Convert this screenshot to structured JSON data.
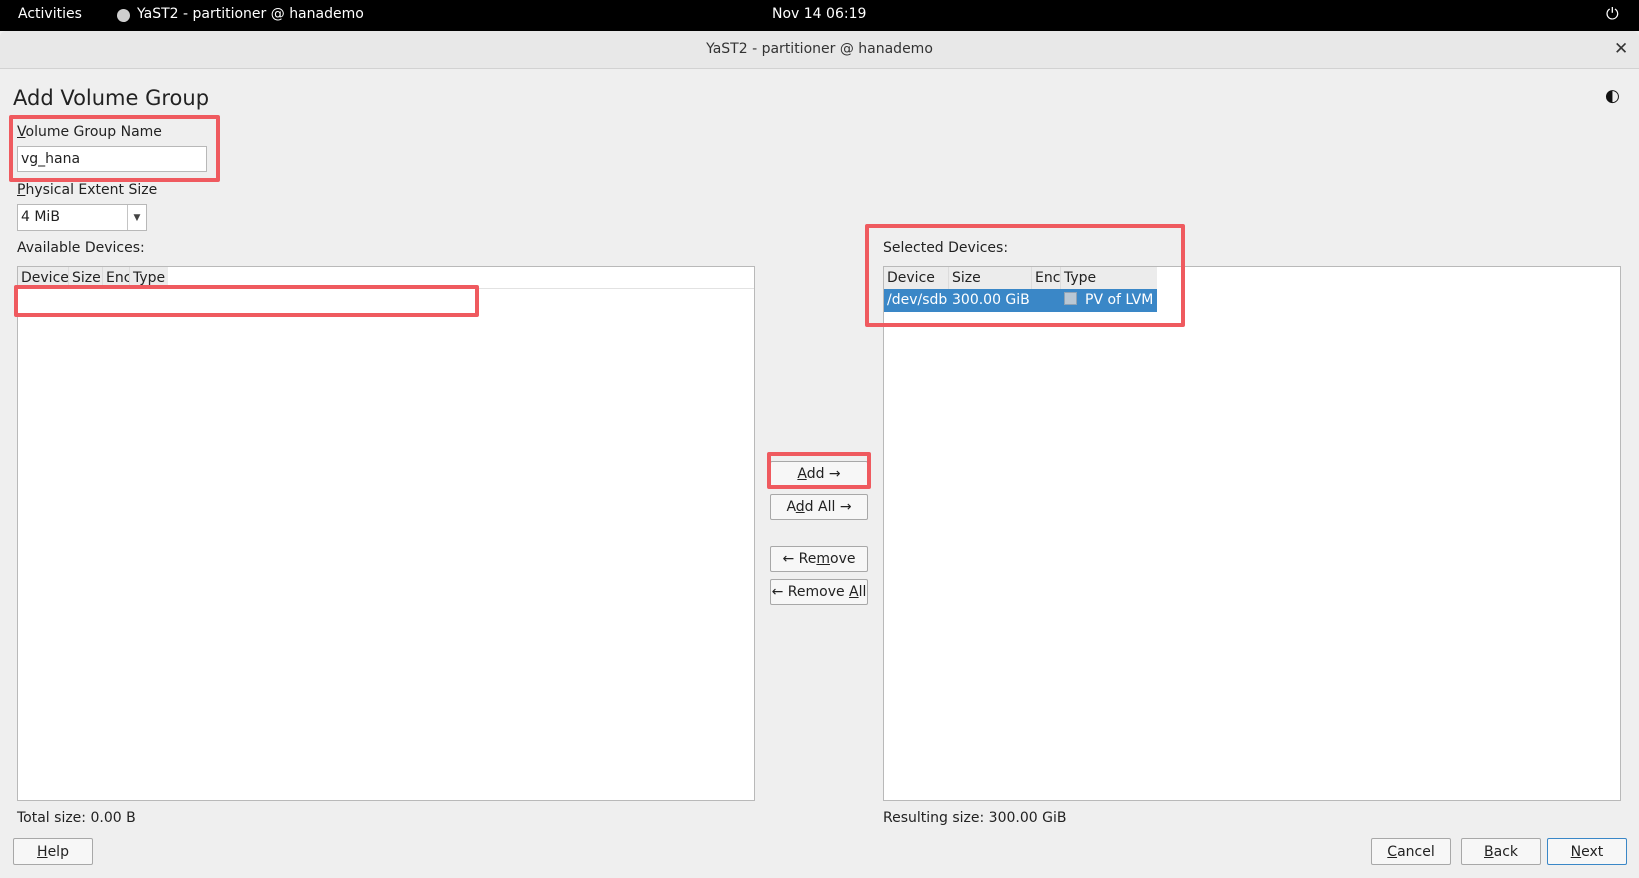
{
  "topbar": {
    "activities": "Activities",
    "app_name": "YaST2 - partitioner @ hanademo",
    "clock": "Nov 14  06:19",
    "power_icon": "⏻"
  },
  "window": {
    "title": "YaST2 - partitioner @ hanademo",
    "close_glyph": "✕"
  },
  "dialog": {
    "heading": "Add Volume Group",
    "theme_icon": "◐"
  },
  "vg_name": {
    "label_first": "V",
    "label_rest": "olume Group Name",
    "value": "vg_hana"
  },
  "extent": {
    "label_first": "P",
    "label_rest": "hysical Extent Size",
    "value": "4 MiB",
    "arrow": "▼"
  },
  "available": {
    "label": "Available Devices:",
    "columns": [
      "Device",
      "Size",
      "Enc",
      "Type"
    ],
    "total": "Total size: 0.00 B"
  },
  "selected": {
    "label": "Selected Devices:",
    "columns": [
      "Device",
      "Size",
      "Enc",
      "Type"
    ],
    "rows": [
      {
        "device": "/dev/sdb",
        "size": "300.00 GiB",
        "enc": "",
        "type": "PV of LVM"
      }
    ],
    "resulting": "Resulting size: 300.00 GiB"
  },
  "actions": {
    "add": {
      "first": "A",
      "rest": "dd →"
    },
    "add_all": {
      "pre": "A",
      "u": "d",
      "rest": "d All →"
    },
    "remove": {
      "pre": "← Re",
      "u": "m",
      "rest": "ove"
    },
    "remove_all": {
      "pre": "← Remove ",
      "u": "A",
      "rest": "ll"
    }
  },
  "footer": {
    "help": {
      "first": "H",
      "rest": "elp"
    },
    "cancel": {
      "first": "C",
      "rest": "ancel"
    },
    "back": {
      "first": "B",
      "rest": "ack"
    },
    "next": {
      "first": "N",
      "rest": "ext"
    }
  }
}
